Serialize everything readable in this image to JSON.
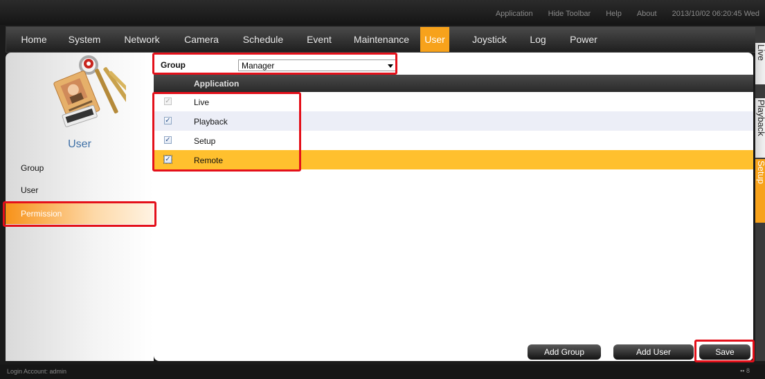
{
  "toolbar": {
    "application": "Application",
    "hide_toolbar": "Hide Toolbar",
    "help": "Help",
    "about": "About",
    "datetime": "2013/10/02 06:20:45 Wed"
  },
  "nav": {
    "home": "Home",
    "system": "System",
    "network": "Network",
    "camera": "Camera",
    "schedule": "Schedule",
    "event": "Event",
    "maintenance": "Maintenance",
    "user": "User",
    "joystick": "Joystick",
    "log": "Log",
    "power": "Power"
  },
  "sidebar": {
    "title": "User",
    "items": [
      "Group",
      "User",
      "Permission"
    ]
  },
  "group": {
    "label": "Group",
    "selected": "Manager"
  },
  "table": {
    "header": "Application",
    "rows": [
      {
        "label": "Live",
        "checked": true,
        "disabled": true
      },
      {
        "label": "Playback",
        "checked": true
      },
      {
        "label": "Setup",
        "checked": true
      },
      {
        "label": "Remote",
        "checked": true,
        "selected": true
      }
    ]
  },
  "buttons": {
    "add_group": "Add Group",
    "add_user": "Add User",
    "save": "Save"
  },
  "right_tabs": {
    "live": "Live",
    "playback": "Playback",
    "setup": "Setup"
  },
  "status": {
    "account": "Login Account: admin",
    "net_count": "8"
  },
  "colors": {
    "accent": "#f7a21b",
    "highlight_row": "#ffc02e",
    "annotation": "#e4101a"
  }
}
